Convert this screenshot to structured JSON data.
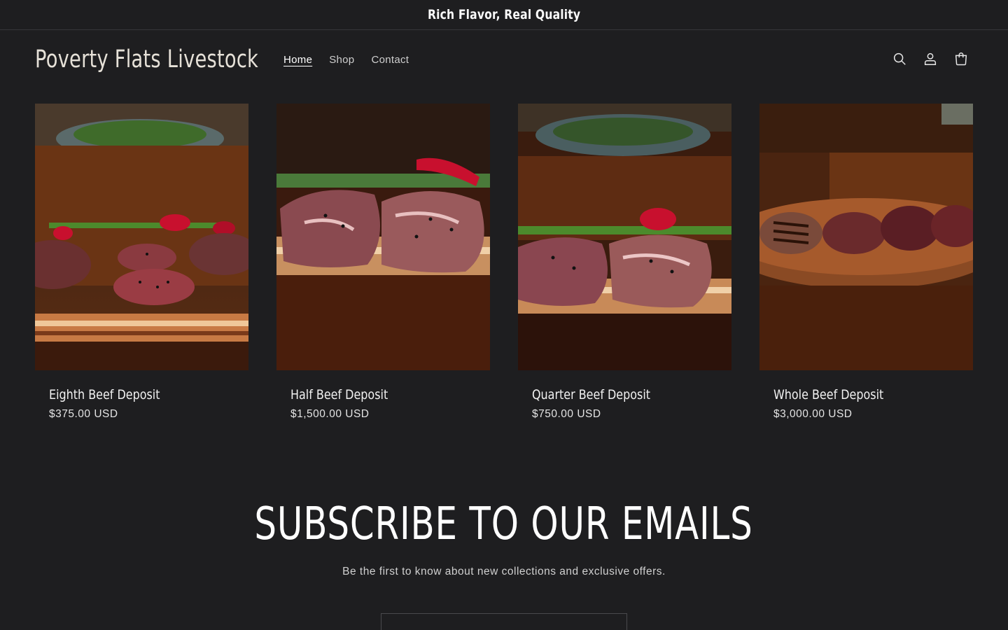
{
  "announcement": {
    "text": "Rich Flavor, Real Quality"
  },
  "header": {
    "logo": "Poverty Flats Livestock",
    "nav": [
      {
        "label": "Home",
        "active": true
      },
      {
        "label": "Shop",
        "active": false
      },
      {
        "label": "Contact",
        "active": false
      }
    ],
    "icons": [
      "search-icon",
      "account-icon",
      "cart-icon"
    ]
  },
  "products": [
    {
      "title": "Eighth Beef Deposit",
      "price": "$375.00 USD",
      "image": "ground-beef-patties"
    },
    {
      "title": "Half Beef Deposit",
      "price": "$1,500.00 USD",
      "image": "beef-steaks-closeup"
    },
    {
      "title": "Quarter Beef Deposit",
      "price": "$750.00 USD",
      "image": "beef-steaks-board"
    },
    {
      "title": "Whole Beef Deposit",
      "price": "$3,000.00 USD",
      "image": "grilled-steaks-platter"
    }
  ],
  "subscribe": {
    "heading": "SUBSCRIBE TO OUR EMAILS",
    "text": "Be the first to know about new collections and exclusive offers."
  },
  "colors": {
    "background": "#1e1e20",
    "text": "#f3f3f3",
    "accent": "#c8102e"
  }
}
